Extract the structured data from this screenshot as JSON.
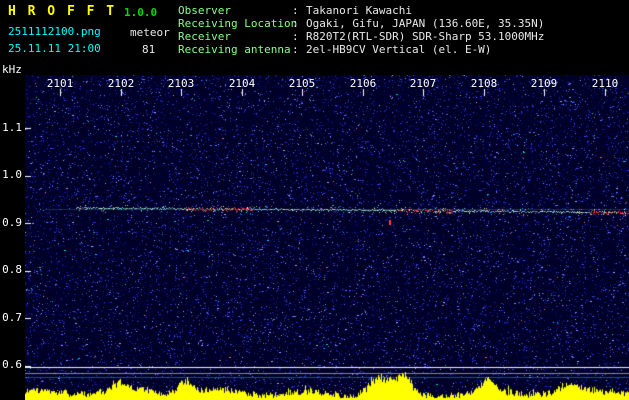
{
  "header": {
    "title": "H R O F F T",
    "version": "1.0.0",
    "filename": "2511112100.png",
    "mode": "meteor",
    "datetime": "25.11.11 21:00",
    "count": "81",
    "info": [
      {
        "label": "Observer",
        "colon": ":",
        "value": "Takanori Kawachi"
      },
      {
        "label": "Receiving Location",
        "colon": ":",
        "value": "Ogaki, Gifu, JAPAN (136.60E, 35.35N)"
      },
      {
        "label": "Receiver",
        "colon": ":",
        "value": "R820T2(RTL-SDR) SDR-Sharp 53.1000MHz"
      },
      {
        "label": "Receiving antenna",
        "colon": ":",
        "value": "2el-HB9CV Vertical (el. E-W)"
      }
    ]
  },
  "axes": {
    "y_unit": "kHz",
    "y_ticks": [
      "1.1",
      "1.0",
      "0.9",
      "0.8",
      "0.7",
      "0.6"
    ],
    "x_ticks": [
      "2101",
      "2102",
      "2103",
      "2104",
      "2105",
      "2106",
      "2107",
      "2108",
      "2109",
      "2110"
    ]
  },
  "colors": {
    "title": "#ffff00",
    "version": "#00dd00",
    "cyan": "#00ffff",
    "white": "#e8e8e8",
    "green": "#88ff88"
  },
  "spectrogram": {
    "bg": "#000028",
    "noise_dots": 17000,
    "noise_palette": [
      {
        "color": "#000060",
        "w": 0.3
      },
      {
        "color": "#101896",
        "w": 0.26
      },
      {
        "color": "#2233cc",
        "w": 0.2
      },
      {
        "color": "#3a4ce6",
        "w": 0.12
      },
      {
        "color": "#6672ff",
        "w": 0.07
      },
      {
        "color": "#9aa4ff",
        "w": 0.035
      },
      {
        "color": "#00c8ff",
        "w": 0.006
      },
      {
        "color": "#00e08a",
        "w": 0.005
      },
      {
        "color": "#ff6060",
        "w": 0.004
      }
    ],
    "carrier": {
      "f": 0.93,
      "color": "#40e0d0",
      "alpha": 0.22
    },
    "trace": {
      "x0": 0.085,
      "x1": 1.0,
      "f0": 0.932,
      "f1": 0.922,
      "color": "#c8ffe0",
      "red_color": "#ff4040",
      "red_segments": [
        [
          0.2,
          0.32
        ],
        [
          0.58,
          0.68
        ],
        [
          0.93,
          1.0
        ]
      ]
    },
    "red_tick": {
      "x": 0.602,
      "f": 0.906
    },
    "baselines": [
      {
        "f": 0.597,
        "color": "#ffffff",
        "alpha": 0.95
      },
      {
        "f": 0.585,
        "color": "#c0c0c0",
        "alpha": 0.7
      },
      {
        "f": 0.575,
        "color": "#00cccc",
        "alpha": 0.45
      }
    ],
    "bars": {
      "color": "#ffff00",
      "base": 4,
      "peaks": [
        {
          "pos": 0.155,
          "amp": 7,
          "w": 0.01
        },
        {
          "pos": 0.265,
          "amp": 14,
          "w": 0.01
        },
        {
          "pos": 0.585,
          "amp": 16,
          "w": 0.018
        },
        {
          "pos": 0.625,
          "amp": 17,
          "w": 0.012
        },
        {
          "pos": 0.765,
          "amp": 12,
          "w": 0.01
        },
        {
          "pos": 0.9,
          "amp": 6,
          "w": 0.012
        }
      ]
    }
  }
}
